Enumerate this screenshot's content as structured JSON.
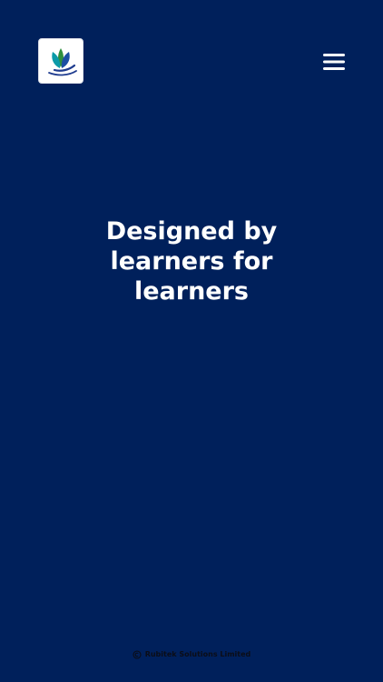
{
  "header": {
    "logo_icon": "brand-logo-icon",
    "menu_icon": "hamburger-menu-icon"
  },
  "hero": {
    "headline": "Designed by learners for learners"
  },
  "footer": {
    "copyright_icon": "copyright-icon",
    "company": "Rubitek Solutions Limited"
  },
  "colors": {
    "background": "#00205b",
    "hero_text": "#ffffff",
    "footer_text": "#0b0d17"
  }
}
